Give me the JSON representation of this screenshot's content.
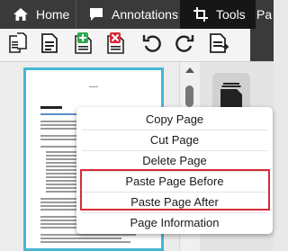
{
  "tabs": [
    {
      "label": "Home",
      "icon": "home-icon"
    },
    {
      "label": "Annotations",
      "icon": "annotations-icon"
    },
    {
      "label": "Tools",
      "icon": "crop-icon",
      "active": true
    },
    {
      "label": "Pa"
    }
  ],
  "toolbar": {
    "buttons": [
      {
        "name": "page-thumbnails-icon"
      },
      {
        "name": "page-thumbnail-icon"
      },
      {
        "name": "insert-page-icon",
        "color": "#2fa84f"
      },
      {
        "name": "delete-page-icon",
        "color": "#d62b38"
      },
      {
        "name": "undo-icon"
      },
      {
        "name": "redo-icon"
      },
      {
        "name": "export-page-icon"
      }
    ]
  },
  "context_menu": {
    "items": [
      "Copy Page",
      "Cut Page",
      "Delete Page",
      "Paste Page Before",
      "Paste Page After",
      "Page Information"
    ],
    "highlighted": [
      "Paste Page Before",
      "Paste Page After"
    ],
    "highlight_color": "#d62b38"
  },
  "colors": {
    "tabbar_bg": "#3a3a3a",
    "active_tab_bg": "#161616",
    "selection_border": "#45b7d3"
  }
}
